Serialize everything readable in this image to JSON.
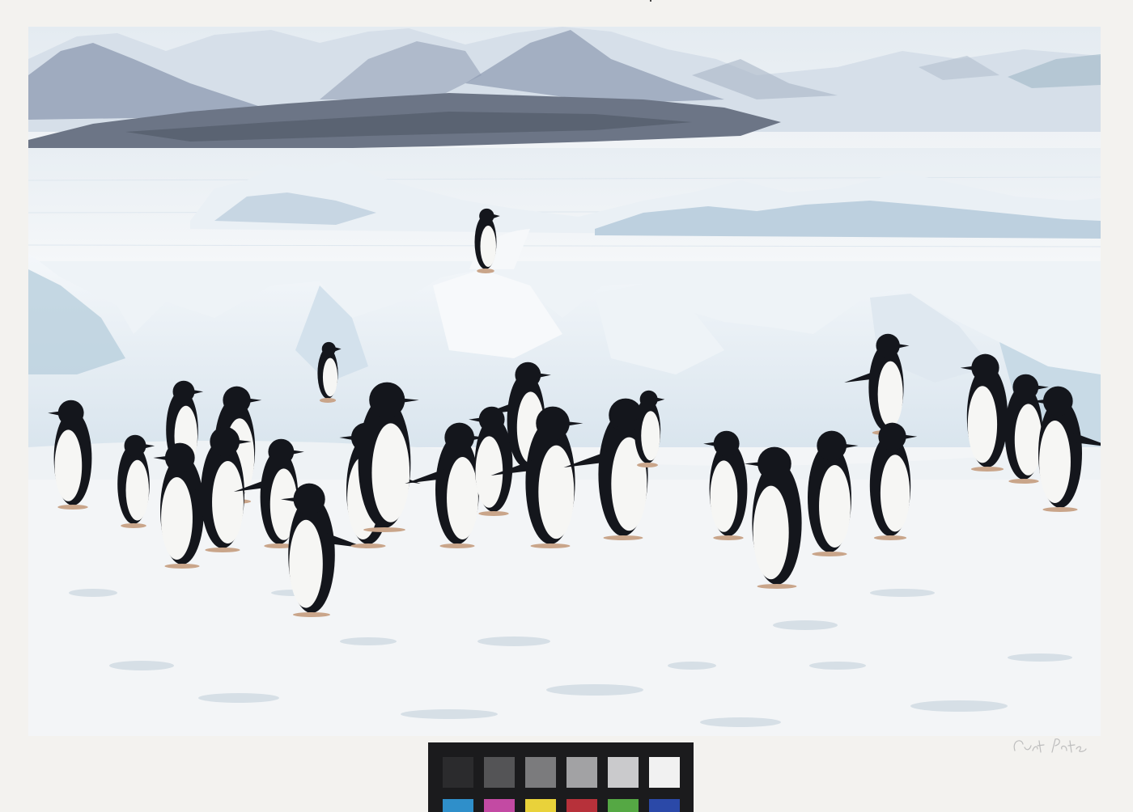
{
  "photograph": {
    "subject": "penguins",
    "colors": {
      "sky": "#e9eff4",
      "mountain_light": "#c9d5e2",
      "mountain_dark": "#7c8aa0",
      "dark_ridge": "#5d6676",
      "ice": "#eef2f6",
      "ice_shadow": "#c5d6e4",
      "snow": "#f4f6f8",
      "penguin_black": "#14161c",
      "penguin_white": "#f6f6f4"
    }
  },
  "signature": {
    "text": "Curt Pate",
    "color": "#b9b9b9"
  },
  "color_target": {
    "grayscale": [
      "#2b2b2d",
      "#545456",
      "#7b7b7d",
      "#a2a2a4",
      "#cacacc",
      "#f1f1f1"
    ],
    "colors": [
      "#2f8fca",
      "#c34aa3",
      "#e9d23a",
      "#b7313a",
      "#55a844",
      "#2b49a8"
    ]
  }
}
